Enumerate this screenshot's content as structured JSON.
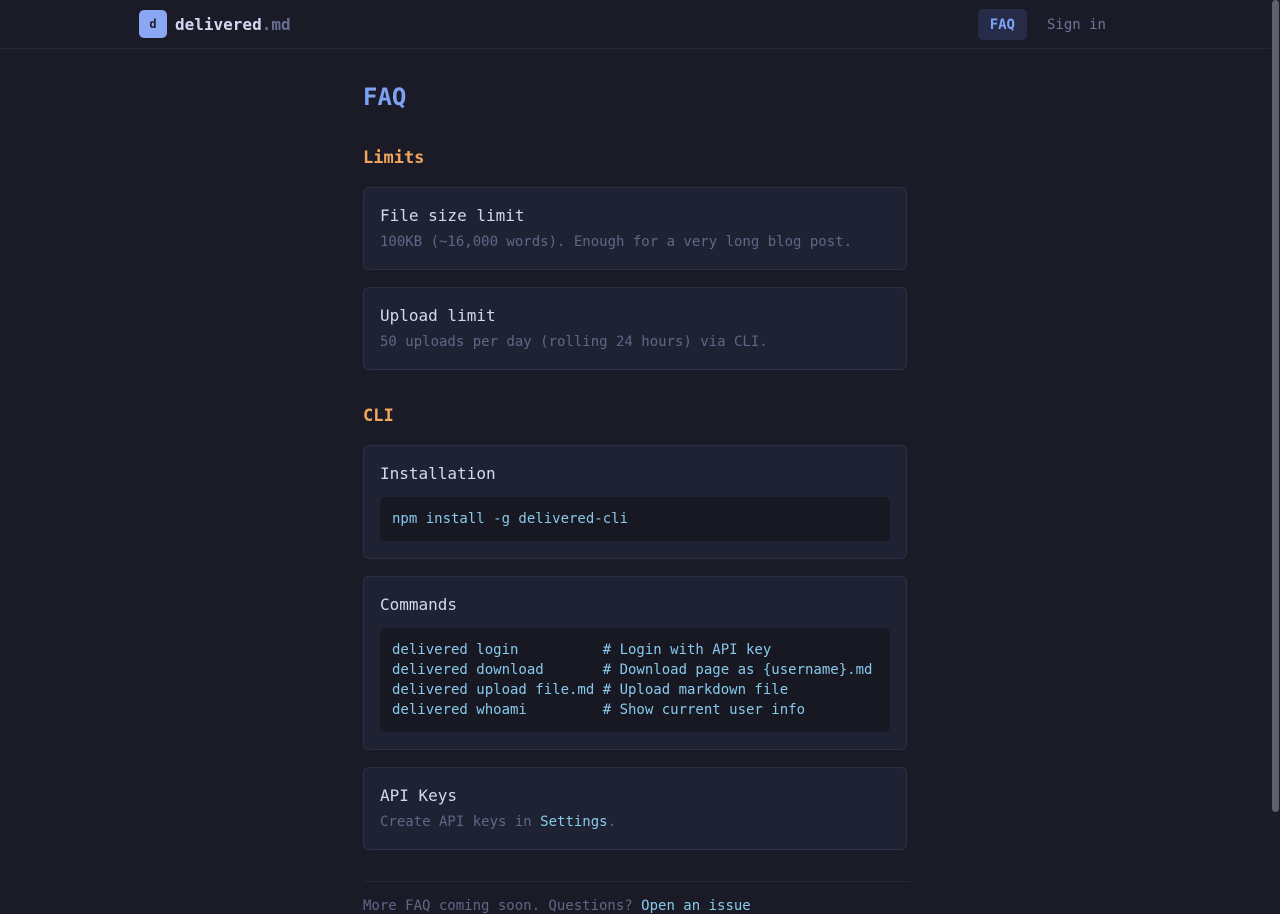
{
  "header": {
    "logo_letter": "d",
    "brand_name": "delivered",
    "brand_ext": ".md",
    "nav": {
      "faq": "FAQ",
      "sign_in": "Sign in"
    }
  },
  "page": {
    "title": "FAQ"
  },
  "sections": {
    "limits": {
      "title": "Limits",
      "file_size": {
        "title": "File size limit",
        "desc": "100KB (~16,000 words). Enough for a very long blog post."
      },
      "upload": {
        "title": "Upload limit",
        "desc": "50 uploads per day (rolling 24 hours) via CLI."
      }
    },
    "cli": {
      "title": "CLI",
      "installation": {
        "title": "Installation",
        "code": "npm install -g delivered-cli"
      },
      "commands": {
        "title": "Commands",
        "lines": [
          "delivered login          # Login with API key",
          "delivered download       # Download page as {username}.md",
          "delivered upload file.md # Upload markdown file",
          "delivered whoami         # Show current user info"
        ]
      },
      "api_keys": {
        "title": "API Keys",
        "desc_prefix": "Create API keys in ",
        "link": "Settings",
        "desc_suffix": "."
      }
    }
  },
  "footer": {
    "text": "More FAQ coming soon. Questions? ",
    "link": "Open an issue"
  },
  "colors": {
    "background": "#1b1b27",
    "accent_blue": "#7ea1f2",
    "section_orange": "#f0a75b",
    "code_cyan": "#86c9ec"
  }
}
